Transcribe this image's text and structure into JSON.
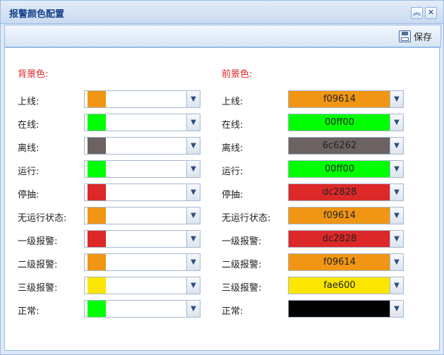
{
  "window": {
    "title": "报警颜色配置"
  },
  "toolbar": {
    "save_label": "保存"
  },
  "sections": {
    "background": "背景色:",
    "foreground": "前景色:"
  },
  "rows": [
    {
      "label": "上线:",
      "bg_color": "#f09614",
      "fg_text": "f09614",
      "fg_color": "#f09614"
    },
    {
      "label": "在线:",
      "bg_color": "#00ff00",
      "fg_text": "00ff00",
      "fg_color": "#00ff00"
    },
    {
      "label": "离线:",
      "bg_color": "#6c6262",
      "fg_text": "6c6262",
      "fg_color": "#6c6262"
    },
    {
      "label": "运行:",
      "bg_color": "#00ff00",
      "fg_text": "00ff00",
      "fg_color": "#00ff00"
    },
    {
      "label": "停抽:",
      "bg_color": "#dc2828",
      "fg_text": "dc2828",
      "fg_color": "#dc2828"
    },
    {
      "label": "无运行状态:",
      "bg_color": "#f09614",
      "fg_text": "f09614",
      "fg_color": "#f09614"
    },
    {
      "label": "一级报警:",
      "bg_color": "#dc2828",
      "fg_text": "dc2828",
      "fg_color": "#dc2828"
    },
    {
      "label": "二级报警:",
      "bg_color": "#f09614",
      "fg_text": "f09614",
      "fg_color": "#f09614"
    },
    {
      "label": "三级报警:",
      "bg_color": "#fae600",
      "fg_text": "fae600",
      "fg_color": "#fae600"
    },
    {
      "label": "正常:",
      "bg_color": "#00ff00",
      "fg_text": "",
      "fg_color": "#000000"
    }
  ],
  "icons": {
    "collapse": "collapse-icon",
    "close": "close-icon",
    "save": "floppy-disk-icon",
    "dropdown": "chevron-down-icon"
  }
}
